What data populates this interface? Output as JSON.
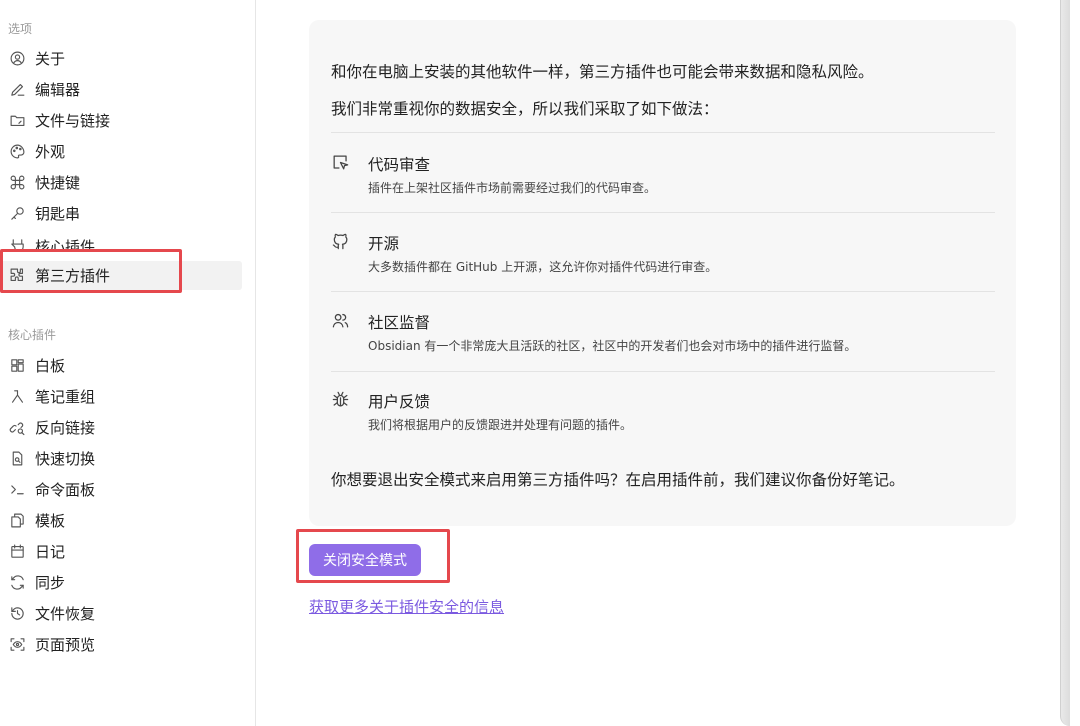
{
  "sidebar": {
    "options_title": "选项",
    "options": [
      {
        "label": "关于",
        "icon": "user-circle-icon"
      },
      {
        "label": "编辑器",
        "icon": "pencil-icon"
      },
      {
        "label": "文件与链接",
        "icon": "folder-icon"
      },
      {
        "label": "外观",
        "icon": "palette-icon"
      },
      {
        "label": "快捷键",
        "icon": "command-icon"
      },
      {
        "label": "钥匙串",
        "icon": "key-icon"
      },
      {
        "label": "核心插件",
        "icon": "plug-icon"
      },
      {
        "label": "第三方插件",
        "icon": "puzzle-icon",
        "active": true
      }
    ],
    "core_title": "核心插件",
    "core": [
      {
        "label": "白板",
        "icon": "layout-dashboard-icon"
      },
      {
        "label": "笔记重组",
        "icon": "merge-icon"
      },
      {
        "label": "反向链接",
        "icon": "link-search-icon"
      },
      {
        "label": "快速切换",
        "icon": "file-search-icon"
      },
      {
        "label": "命令面板",
        "icon": "terminal-icon"
      },
      {
        "label": "模板",
        "icon": "files-icon"
      },
      {
        "label": "日记",
        "icon": "calendar-icon"
      },
      {
        "label": "同步",
        "icon": "refresh-icon"
      },
      {
        "label": "文件恢复",
        "icon": "history-icon"
      },
      {
        "label": "页面预览",
        "icon": "eye-scan-icon"
      }
    ]
  },
  "main": {
    "intro_1": "和你在电脑上安装的其他软件一样，第三方插件也可能会带来数据和隐私风险。",
    "intro_2": "我们非常重视你的数据安全，所以我们采取了如下做法：",
    "features": [
      {
        "title": "代码审查",
        "desc": "插件在上架社区插件市场前需要经过我们的代码审查。",
        "icon": "cursor-review-icon"
      },
      {
        "title": "开源",
        "desc": "大多数插件都在 GitHub 上开源，这允许你对插件代码进行审查。",
        "icon": "github-icon"
      },
      {
        "title": "社区监督",
        "desc": "Obsidian 有一个非常庞大且活跃的社区，社区中的开发者们也会对市场中的插件进行监督。",
        "icon": "users-icon"
      },
      {
        "title": "用户反馈",
        "desc": "我们将根据用户的反馈跟进并处理有问题的插件。",
        "icon": "bug-icon"
      }
    ],
    "question": "你想要退出安全模式来启用第三方插件吗？在启用插件前，我们建议你备份好笔记。",
    "button_label": "关闭安全模式",
    "link_label": "获取更多关于插件安全的信息"
  },
  "colors": {
    "accent": "#8f6de8",
    "link": "#7b5ae0",
    "annotation": "#e5484d"
  }
}
